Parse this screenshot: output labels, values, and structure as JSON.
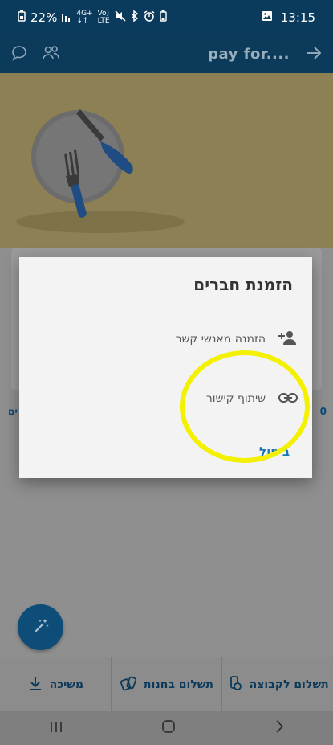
{
  "status": {
    "battery": "22%",
    "net_top": "4G+",
    "net_bottom": "LTE",
    "volte_top": "Vo)",
    "volte_bottom": "LTE",
    "time": "13:15"
  },
  "app_bar": {
    "title": "pay for...."
  },
  "page": {
    "left_num": "0"
  },
  "dialog": {
    "title": "הזמנת חברים",
    "options": [
      {
        "label": "הזמנה מאנשי קשר",
        "icon": "add-person-icon"
      },
      {
        "label": "שיתוף קישור",
        "icon": "link-icon"
      }
    ],
    "cancel": "ביטול"
  },
  "bottom_actions": [
    {
      "label": "תשלום לקבוצה",
      "icon": "pay-group-icon"
    },
    {
      "label": "תשלום בחנות",
      "icon": "pay-store-icon"
    },
    {
      "label": "משיכה",
      "icon": "withdraw-icon"
    }
  ],
  "colors": {
    "brand": "#0b3a5b",
    "accent": "#1976b6",
    "highlight": "#f3f000"
  }
}
